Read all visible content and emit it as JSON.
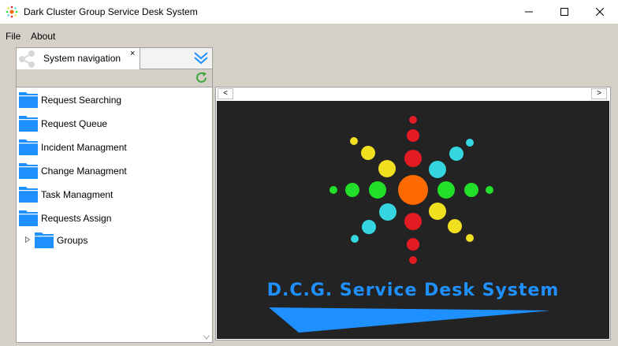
{
  "window": {
    "title": "Dark Cluster Group Service Desk System",
    "minimize_icon": "minimize-icon",
    "maximize_icon": "maximize-icon",
    "close_icon": "close-icon"
  },
  "menu": {
    "items": [
      {
        "label": "File"
      },
      {
        "label": "About"
      }
    ]
  },
  "nav": {
    "tab_label": "System navigation",
    "tab_close": "×",
    "tab_icon": "share-icon",
    "collapse_icon": "double-chevron-down-icon",
    "refresh_icon": "refresh-icon",
    "items": [
      {
        "label": "Request Searching",
        "icon": "folder-icon"
      },
      {
        "label": "Request Queue",
        "icon": "folder-icon"
      },
      {
        "label": "Incident Managment",
        "icon": "folder-icon"
      },
      {
        "label": "Change Managment",
        "icon": "folder-icon"
      },
      {
        "label": "Task Managment",
        "icon": "folder-icon"
      },
      {
        "label": "Requests Assign",
        "icon": "folder-icon"
      },
      {
        "label": "Groups",
        "icon": "folder-icon",
        "collapsed": true
      }
    ],
    "accent_color": "#1e90ff"
  },
  "content": {
    "scroll_left": "<",
    "scroll_right": ">",
    "splash_title": "D.C.G. Service Desk System",
    "splash_background": "#232323",
    "splash_accent": "#1e90ff",
    "dot_colors": [
      "#ff6a00",
      "#e31b23",
      "#f0e020",
      "#35d6e0",
      "#22e02a"
    ]
  }
}
